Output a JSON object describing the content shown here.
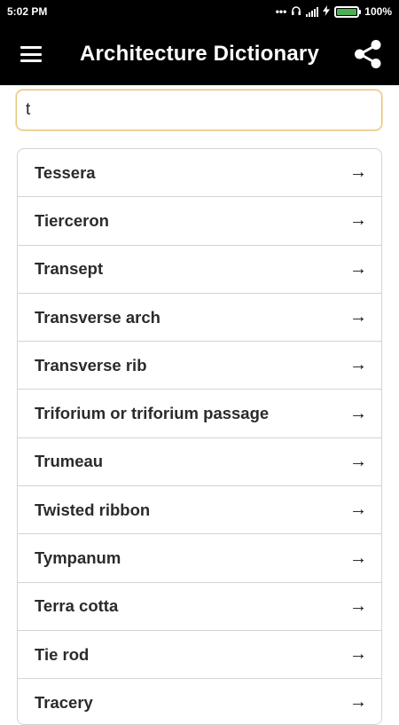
{
  "statusbar": {
    "time": "5:02 PM",
    "battery_text": "100%",
    "icons": [
      "dots-icon",
      "headphones-icon",
      "signal-icon",
      "charging-icon",
      "battery-icon"
    ]
  },
  "appbar": {
    "title": "Architecture Dictionary",
    "menu_icon": "hamburger-icon",
    "share_icon": "share-icon"
  },
  "search": {
    "value": "t",
    "placeholder": ""
  },
  "list": {
    "arrow": "→",
    "items": [
      {
        "label": "Tessera"
      },
      {
        "label": "Tierceron"
      },
      {
        "label": "Transept"
      },
      {
        "label": "Transverse arch"
      },
      {
        "label": "Transverse rib"
      },
      {
        "label": "Triforium or triforium passage"
      },
      {
        "label": "Trumeau"
      },
      {
        "label": "Twisted ribbon"
      },
      {
        "label": "Tympanum"
      },
      {
        "label": "Terra cotta"
      },
      {
        "label": "Tie rod"
      },
      {
        "label": "Tracery"
      }
    ]
  },
  "colors": {
    "appbar_bg": "#000000",
    "battery_fill": "#4caf50",
    "search_border": "#e8c27a"
  }
}
